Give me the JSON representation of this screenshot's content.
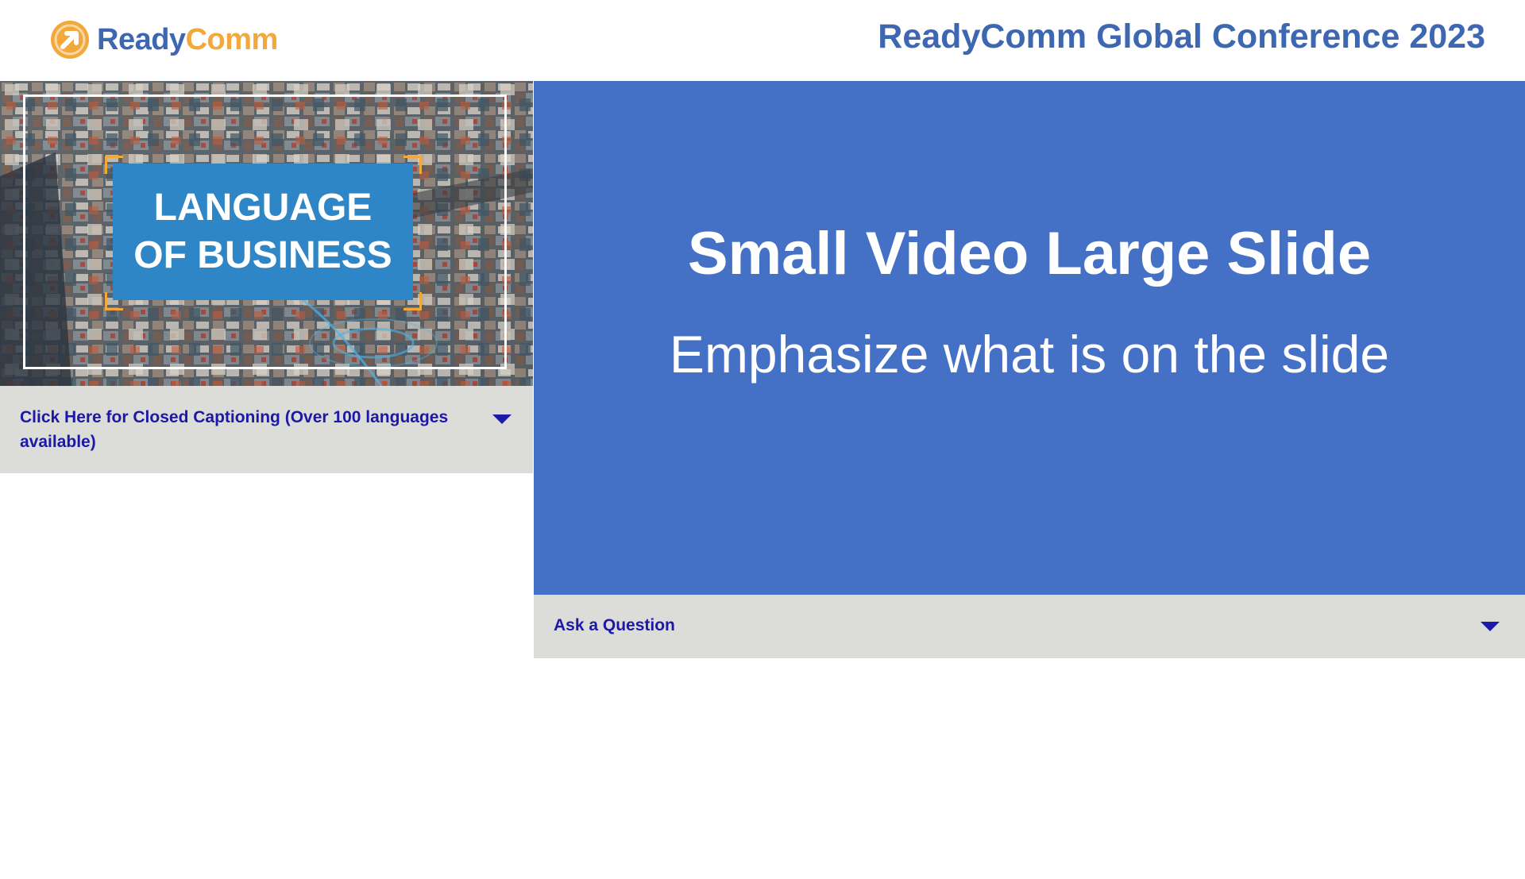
{
  "header": {
    "logo": {
      "part1": "Ready",
      "part2": "Comm",
      "icon": "arrow-circle-icon"
    },
    "conference_title": "ReadyComm Global Conference 2023"
  },
  "video": {
    "title_line1": "LANGUAGE",
    "title_line2": "OF BUSINESS"
  },
  "captions": {
    "label": "Click Here for Closed Captioning (Over 100 languages available)",
    "icon": "chevron-down-icon"
  },
  "slide": {
    "title": "Small Video Large Slide",
    "subtitle": "Emphasize what is on the slide"
  },
  "question": {
    "label": "Ask a Question",
    "icon": "chevron-down-icon"
  },
  "colors": {
    "brand_blue": "#3d67b1",
    "brand_orange": "#f2a83b",
    "slide_blue": "#4471c6",
    "bar_gray": "#dcdcd9",
    "link_navy": "#1c18a8",
    "title_card_blue": "#2e86c6"
  }
}
